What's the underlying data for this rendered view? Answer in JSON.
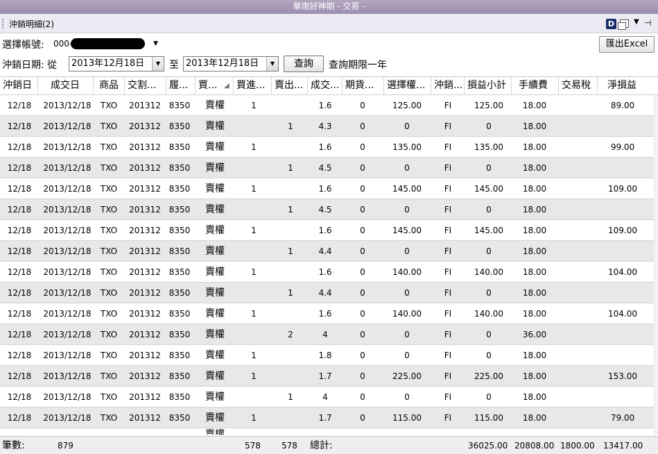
{
  "window": {
    "title": "華南好神期 - 交易 -"
  },
  "panel": {
    "title": "沖銷明細(2)",
    "dock_icon_letter": "D"
  },
  "account": {
    "label": "選擇帳號:",
    "value_prefix": "000-"
  },
  "export_button": "匯出Excel",
  "date": {
    "label": "沖銷日期: 從",
    "from": "2013年12月18日",
    "to_label": "至",
    "to": "2013年12月18日",
    "query_button": "查詢",
    "note": "查詢期限一年"
  },
  "table": {
    "columns": [
      "沖銷日",
      "成交日",
      "商品",
      "交割...",
      "履...",
      "買...",
      "買進...",
      "賣出...",
      "成交...",
      "期貨...",
      "選擇權...",
      "沖銷...",
      "損益小計",
      "手續費",
      "交易稅",
      "淨損益"
    ],
    "rows": [
      [
        "12/18",
        "2013/12/18",
        "TXO",
        "201312",
        "8350",
        "賣權",
        "1",
        "",
        "1.6",
        "0",
        "125.00",
        "FI",
        "125.00",
        "18.00",
        "",
        "89.00"
      ],
      [
        "12/18",
        "2013/12/18",
        "TXO",
        "201312",
        "8350",
        "賣權",
        "",
        "1",
        "4.3",
        "0",
        "0",
        "FI",
        "0",
        "18.00",
        "",
        ""
      ],
      [
        "12/18",
        "2013/12/18",
        "TXO",
        "201312",
        "8350",
        "賣權",
        "1",
        "",
        "1.6",
        "0",
        "135.00",
        "FI",
        "135.00",
        "18.00",
        "",
        "99.00"
      ],
      [
        "12/18",
        "2013/12/18",
        "TXO",
        "201312",
        "8350",
        "賣權",
        "",
        "1",
        "4.5",
        "0",
        "0",
        "FI",
        "0",
        "18.00",
        "",
        ""
      ],
      [
        "12/18",
        "2013/12/18",
        "TXO",
        "201312",
        "8350",
        "賣權",
        "1",
        "",
        "1.6",
        "0",
        "145.00",
        "FI",
        "145.00",
        "18.00",
        "",
        "109.00"
      ],
      [
        "12/18",
        "2013/12/18",
        "TXO",
        "201312",
        "8350",
        "賣權",
        "",
        "1",
        "4.5",
        "0",
        "0",
        "FI",
        "0",
        "18.00",
        "",
        ""
      ],
      [
        "12/18",
        "2013/12/18",
        "TXO",
        "201312",
        "8350",
        "賣權",
        "1",
        "",
        "1.6",
        "0",
        "145.00",
        "FI",
        "145.00",
        "18.00",
        "",
        "109.00"
      ],
      [
        "12/18",
        "2013/12/18",
        "TXO",
        "201312",
        "8350",
        "賣權",
        "",
        "1",
        "4.4",
        "0",
        "0",
        "FI",
        "0",
        "18.00",
        "",
        ""
      ],
      [
        "12/18",
        "2013/12/18",
        "TXO",
        "201312",
        "8350",
        "賣權",
        "1",
        "",
        "1.6",
        "0",
        "140.00",
        "FI",
        "140.00",
        "18.00",
        "",
        "104.00"
      ],
      [
        "12/18",
        "2013/12/18",
        "TXO",
        "201312",
        "8350",
        "賣權",
        "",
        "1",
        "4.4",
        "0",
        "0",
        "FI",
        "0",
        "18.00",
        "",
        ""
      ],
      [
        "12/18",
        "2013/12/18",
        "TXO",
        "201312",
        "8350",
        "賣權",
        "1",
        "",
        "1.6",
        "0",
        "140.00",
        "FI",
        "140.00",
        "18.00",
        "",
        "104.00"
      ],
      [
        "12/18",
        "2013/12/18",
        "TXO",
        "201312",
        "8350",
        "賣權",
        "",
        "2",
        "4",
        "0",
        "0",
        "FI",
        "0",
        "36.00",
        "",
        ""
      ],
      [
        "12/18",
        "2013/12/18",
        "TXO",
        "201312",
        "8350",
        "賣權",
        "1",
        "",
        "1.8",
        "0",
        "0",
        "FI",
        "0",
        "18.00",
        "",
        ""
      ],
      [
        "12/18",
        "2013/12/18",
        "TXO",
        "201312",
        "8350",
        "賣權",
        "1",
        "",
        "1.7",
        "0",
        "225.00",
        "FI",
        "225.00",
        "18.00",
        "",
        "153.00"
      ],
      [
        "12/18",
        "2013/12/18",
        "TXO",
        "201312",
        "8350",
        "賣權",
        "",
        "1",
        "4",
        "0",
        "0",
        "FI",
        "0",
        "18.00",
        "",
        ""
      ],
      [
        "12/18",
        "2013/12/18",
        "TXO",
        "201312",
        "8350",
        "賣權",
        "1",
        "",
        "1.7",
        "0",
        "115.00",
        "FI",
        "115.00",
        "18.00",
        "",
        "79.00"
      ]
    ],
    "partial_row_text": "賣權"
  },
  "footer": {
    "count_label": "筆數:",
    "count": "879",
    "buy_total": "578",
    "sell_total": "578",
    "total_label": "總計:",
    "pnl_subtotal": "36025.00",
    "fee": "20808.00",
    "tax": "1800.00",
    "net": "13417.00"
  }
}
